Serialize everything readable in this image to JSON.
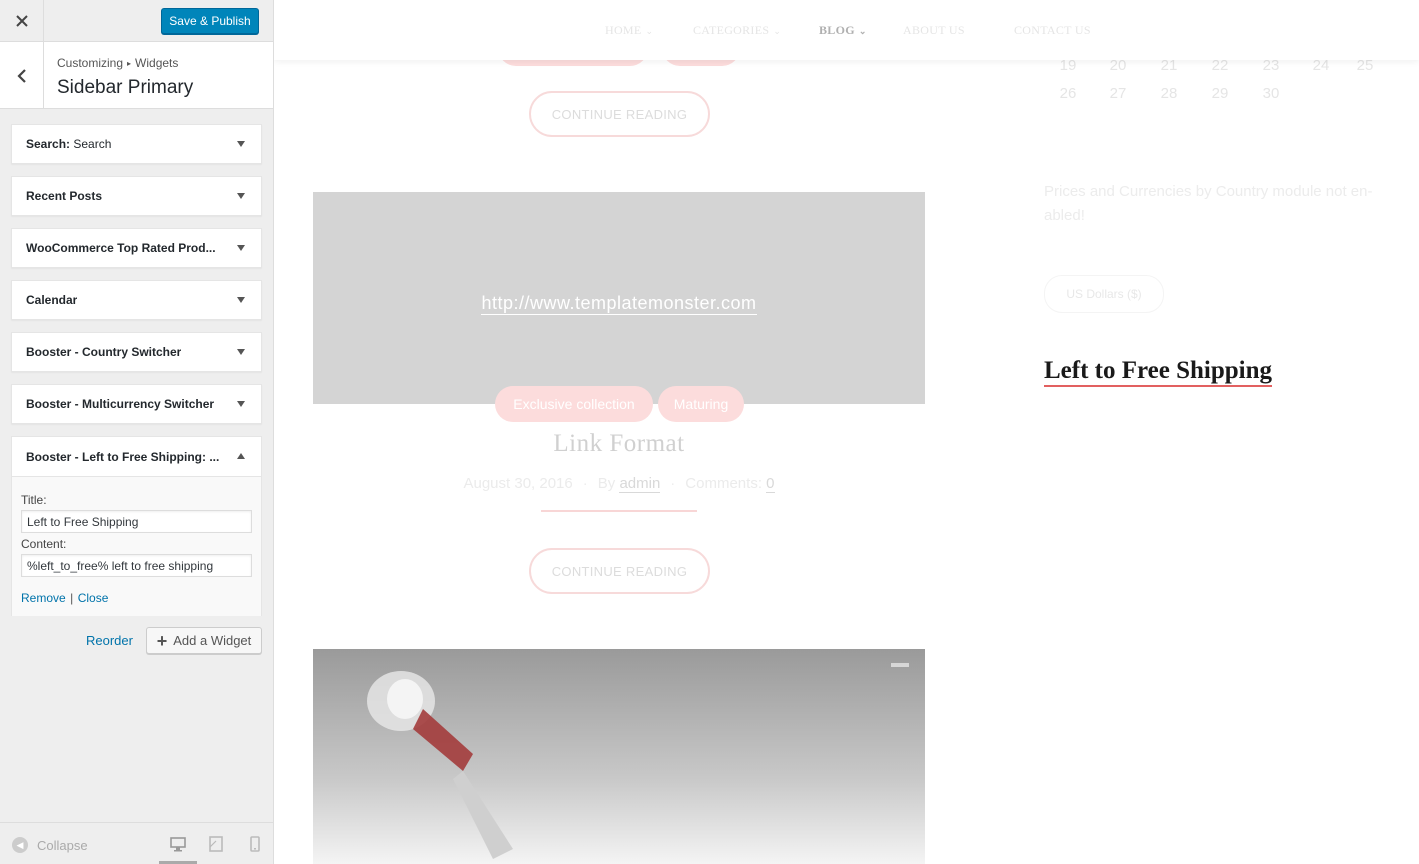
{
  "topbar": {
    "close_icon": "close-icon",
    "publish_label": "Save & Publish",
    "accent": "#0085ba"
  },
  "header": {
    "breadcrumb_root": "Customizing",
    "breadcrumb_sep": "▸",
    "breadcrumb_section": "Widgets",
    "title": "Sidebar Primary"
  },
  "widgets": [
    {
      "label_bold": "Search:",
      "label_light": " Search"
    },
    {
      "label_bold": "Recent Posts",
      "label_light": ""
    },
    {
      "label_bold": "WooCommerce Top Rated Prod...",
      "label_light": ""
    },
    {
      "label_bold": "Calendar",
      "label_light": ""
    },
    {
      "label_bold": "Booster - Country Switcher",
      "label_light": ""
    },
    {
      "label_bold": "Booster - Multicurrency Switcher",
      "label_light": ""
    }
  ],
  "open_widget": {
    "title": "Booster - Left to Free Shipping: ...",
    "title_label": "Title:",
    "title_value": "Left to Free Shipping",
    "content_label": "Content:",
    "content_value": "%left_to_free% left to free shipping",
    "remove": "Remove",
    "sep": "|",
    "close": "Close"
  },
  "actions": {
    "reorder": "Reorder",
    "add_widget": "Add a Widget"
  },
  "footer": {
    "collapse": "Collapse",
    "devices": [
      "desktop-icon",
      "tablet-icon",
      "mobile-icon"
    ]
  },
  "preview": {
    "nav": [
      {
        "label": "HOME",
        "chevron": "⌄",
        "active": false
      },
      {
        "label": "CATEGORIES",
        "chevron": "⌄",
        "active": false
      },
      {
        "label": "BLOG",
        "chevron": "⌄",
        "active": true
      },
      {
        "label": "ABOUT US",
        "chevron": "",
        "active": false
      },
      {
        "label": "CONTACT US",
        "chevron": "",
        "active": false
      }
    ],
    "continue_reading": "CONTINUE READING",
    "link_url": "http://www.templatemonster.com",
    "tags": [
      "Exclusive collection",
      "Maturing"
    ],
    "post_title": "Link Format",
    "post_date": "August 30, 2016",
    "post_by": "By",
    "post_author": "admin",
    "post_comments_label": "Comments:",
    "post_comments": "0",
    "calendar_rows": [
      [
        "19",
        "20",
        "21",
        "22",
        "23",
        "24",
        "25"
      ],
      [
        "26",
        "27",
        "28",
        "29",
        "30"
      ]
    ],
    "prices_note": "Prices and Currencies by Country module not en- abled!",
    "currency": "US Dollars ($)",
    "free_shipping_title": "Left to Free Shipping"
  }
}
